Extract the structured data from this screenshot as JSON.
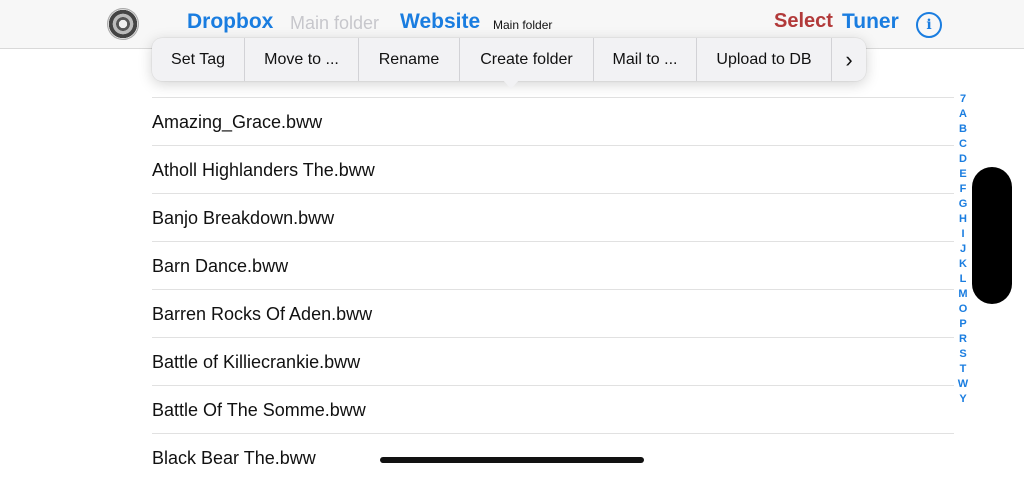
{
  "navbar": {
    "dropbox": "Dropbox",
    "main_folder_1": "Main folder",
    "website": "Website",
    "main_folder_2": "Main folder",
    "select": "Select",
    "tuner": "Tuner",
    "info": "i"
  },
  "context_menu": {
    "items": [
      "Set Tag",
      "Move to ...",
      "Rename",
      "Create folder",
      "Mail to ...",
      "Upload to DB"
    ],
    "more": "›"
  },
  "files": [
    "Amazing_Grace.bww",
    "Atholl Highlanders The.bww",
    "Banjo Breakdown.bww",
    "Barn Dance.bww",
    "Barren Rocks Of Aden.bww",
    "Battle of Killiecrankie.bww",
    "Battle Of The Somme.bww",
    "Black Bear The.bww"
  ],
  "index_letters": [
    "7",
    "A",
    "B",
    "C",
    "D",
    "E",
    "F",
    "G",
    "H",
    "I",
    "J",
    "K",
    "L",
    "M",
    "O",
    "P",
    "R",
    "S",
    "T",
    "W",
    "Y"
  ],
  "colors": {
    "accent": "#1a7de0",
    "select": "#b23a3a"
  }
}
